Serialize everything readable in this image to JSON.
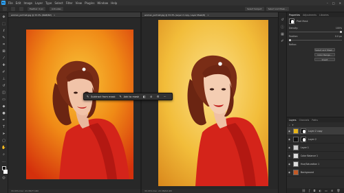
{
  "menu": {
    "logo": "Ps",
    "items": [
      "File",
      "Edit",
      "Image",
      "Layer",
      "Type",
      "Select",
      "Filter",
      "View",
      "Plugins",
      "Window",
      "Help"
    ]
  },
  "options": {
    "feather": "Feather: 0 px",
    "antialias": "Anti-alias",
    "select_subject": "Select Subject",
    "select_mask": "Select and Mask..."
  },
  "docs": {
    "left_tab": "woman_portrait.jpg @ 33.3% (RGB/8#)",
    "left_status": "33.33%    Doc: 23.3M/77.6M",
    "right_tab": "woman_portrait.jpg @ 33.3% (Layer 2 copy, Layer Mask/8)",
    "right_status": "33.33%    Doc: 23.3M/93.6M",
    "close": "×"
  },
  "context_bar": {
    "subtract_label": "Subtract from mask",
    "add_label": "Add to mask",
    "more": "···"
  },
  "properties": {
    "tabs": [
      "Properties",
      "Adjustments",
      "Libraries"
    ],
    "mask_label": "Pixel Mask",
    "density_label": "Density:",
    "density_value": "100%",
    "feather_label": "Feather:",
    "feather_value": "0.0 px",
    "refine_label": "Refine:",
    "buttons": [
      "Select and Mask...",
      "Color Range...",
      "Invert"
    ]
  },
  "layers": {
    "tabs": [
      "Layers",
      "Channels",
      "Paths"
    ],
    "items": [
      {
        "name": "Layer 2 copy",
        "thumb": "#e6b419"
      },
      {
        "name": "Layer 2",
        "thumb": "#000000"
      },
      {
        "name": "Layer 1",
        "thumb": "#cccccc"
      },
      {
        "name": "Color Balance 1",
        "thumb": "#dddddd"
      },
      {
        "name": "Hue/Saturation 1",
        "thumb": "#dddddd"
      },
      {
        "name": "Background",
        "thumb": "#c25a26"
      }
    ]
  },
  "colors": {
    "accent": "#31a8ff",
    "orange": "#f39a1a",
    "red": "#d82a1c",
    "yellow": "#f2c830"
  }
}
